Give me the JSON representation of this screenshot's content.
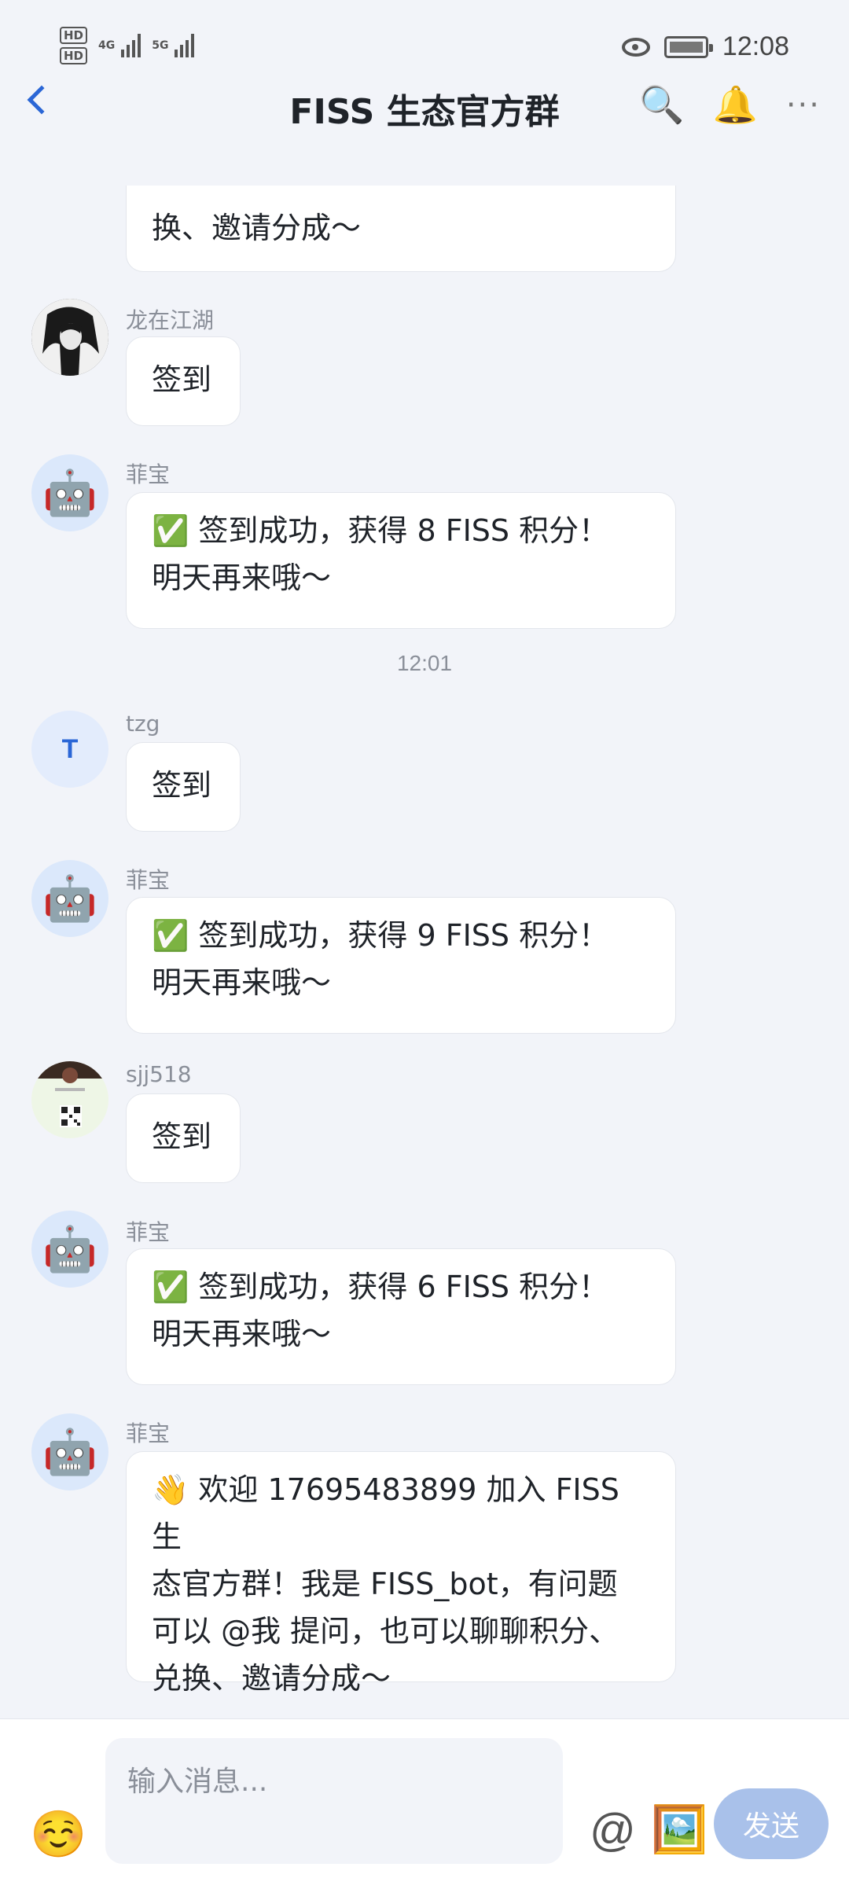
{
  "status_bar": {
    "sim1_label": "HD",
    "sim2_label": "HD",
    "net1": "4G",
    "net2": "5G",
    "time": "12:08"
  },
  "header": {
    "back_icon": "chevron-left-icon",
    "title": "FISS 生态官方群",
    "search_icon": "🔍",
    "bell_icon": "🔔",
    "more_icon": "···"
  },
  "messages": [
    {
      "sender": "",
      "text": "换、邀请分成～"
    },
    {
      "sender": "龙在江湖",
      "text": "签到"
    },
    {
      "sender": "菲宝",
      "line1": "✅ 签到成功，获得 8 FISS 积分！",
      "line2": "明天再来哦～"
    },
    {
      "sender": "tzg",
      "avatar_letter": "T",
      "text": "签到"
    },
    {
      "sender": "菲宝",
      "line1": "✅ 签到成功，获得 9 FISS 积分！",
      "line2": "明天再来哦～"
    },
    {
      "sender": "sjj518",
      "text": "签到"
    },
    {
      "sender": "菲宝",
      "line1": "✅ 签到成功，获得 6 FISS 积分！",
      "line2": "明天再来哦～"
    },
    {
      "sender": "菲宝",
      "line1": "👋 欢迎 17695483899 加入 FISS 生",
      "line2": "态官方群！我是 FISS_bot，有问题",
      "line3": "可以 @我 提问，也可以聊聊积分、",
      "line4": "兑换、邀请分成～"
    }
  ],
  "bot_avatar": "🤖",
  "timestamp": "12:01",
  "composer": {
    "emoji": "☺️",
    "placeholder": "输入消息...",
    "at": "@",
    "image": "🖼️",
    "send_label": "发送"
  },
  "colors": {
    "accent": "#2a66d6",
    "background": "#f2f4f9",
    "send_button": "#a9c1ea"
  }
}
